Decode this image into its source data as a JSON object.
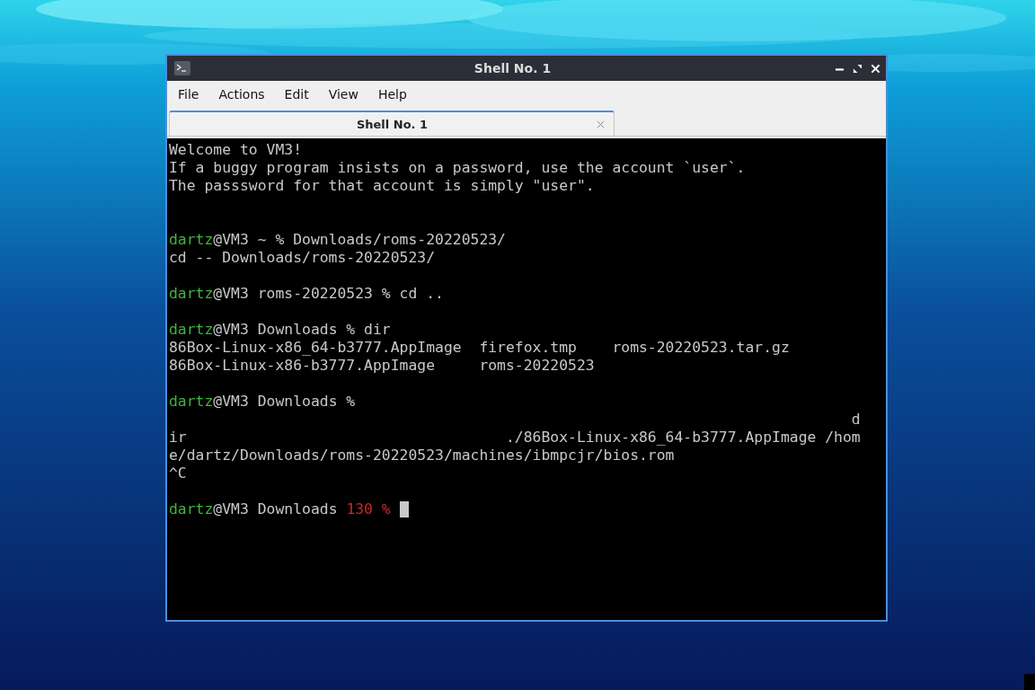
{
  "window": {
    "title": "Shell No. 1"
  },
  "menu": [
    "File",
    "Actions",
    "Edit",
    "View",
    "Help"
  ],
  "tabs": [
    {
      "label": "Shell No. 1",
      "selected": true
    }
  ],
  "terminal": {
    "lines": [
      {
        "kind": "text",
        "segments": [
          {
            "kind": "plain",
            "text": "Welcome to VM3!"
          }
        ]
      },
      {
        "kind": "text",
        "segments": [
          {
            "kind": "plain",
            "text": "If a buggy program insists on a password, use the account `user`."
          }
        ]
      },
      {
        "kind": "text",
        "segments": [
          {
            "kind": "plain",
            "text": "The passsword for that account is simply \"user\"."
          }
        ]
      },
      {
        "kind": "blank"
      },
      {
        "kind": "blank"
      },
      {
        "kind": "text",
        "segments": [
          {
            "kind": "user",
            "text": "dartz"
          },
          {
            "kind": "plain",
            "text": "@VM3 ~ % Downloads/roms-20220523/"
          }
        ]
      },
      {
        "kind": "text",
        "segments": [
          {
            "kind": "plain",
            "text": "cd -- Downloads/roms-20220523/"
          }
        ]
      },
      {
        "kind": "blank"
      },
      {
        "kind": "text",
        "segments": [
          {
            "kind": "user",
            "text": "dartz"
          },
          {
            "kind": "plain",
            "text": "@VM3 roms-20220523 % cd .."
          }
        ]
      },
      {
        "kind": "blank"
      },
      {
        "kind": "text",
        "segments": [
          {
            "kind": "user",
            "text": "dartz"
          },
          {
            "kind": "plain",
            "text": "@VM3 Downloads % dir"
          }
        ]
      },
      {
        "kind": "text",
        "segments": [
          {
            "kind": "plain",
            "text": "86Box-Linux-x86_64-b3777.AppImage  firefox.tmp    roms-20220523.tar.gz"
          }
        ]
      },
      {
        "kind": "text",
        "segments": [
          {
            "kind": "plain",
            "text": "86Box-Linux-x86-b3777.AppImage     roms-20220523"
          }
        ]
      },
      {
        "kind": "blank"
      },
      {
        "kind": "text",
        "segments": [
          {
            "kind": "user",
            "text": "dartz"
          },
          {
            "kind": "plain",
            "text": "@VM3 Downloads %"
          }
        ]
      },
      {
        "kind": "text",
        "segments": [
          {
            "kind": "plain",
            "text": "                                                                             d"
          }
        ]
      },
      {
        "kind": "text",
        "segments": [
          {
            "kind": "plain",
            "text": "ir                                    ./86Box-Linux-x86_64-b3777.AppImage /hom"
          }
        ]
      },
      {
        "kind": "text",
        "segments": [
          {
            "kind": "plain",
            "text": "e/dartz/Downloads/roms-20220523/machines/ibmpcjr/bios.rom"
          }
        ]
      },
      {
        "kind": "text",
        "segments": [
          {
            "kind": "plain",
            "text": "^C"
          }
        ]
      },
      {
        "kind": "blank"
      },
      {
        "kind": "text",
        "cursor": true,
        "segments": [
          {
            "kind": "user",
            "text": "dartz"
          },
          {
            "kind": "plain",
            "text": "@VM3 Downloads "
          },
          {
            "kind": "error",
            "text": "130 %"
          }
        ]
      }
    ]
  }
}
